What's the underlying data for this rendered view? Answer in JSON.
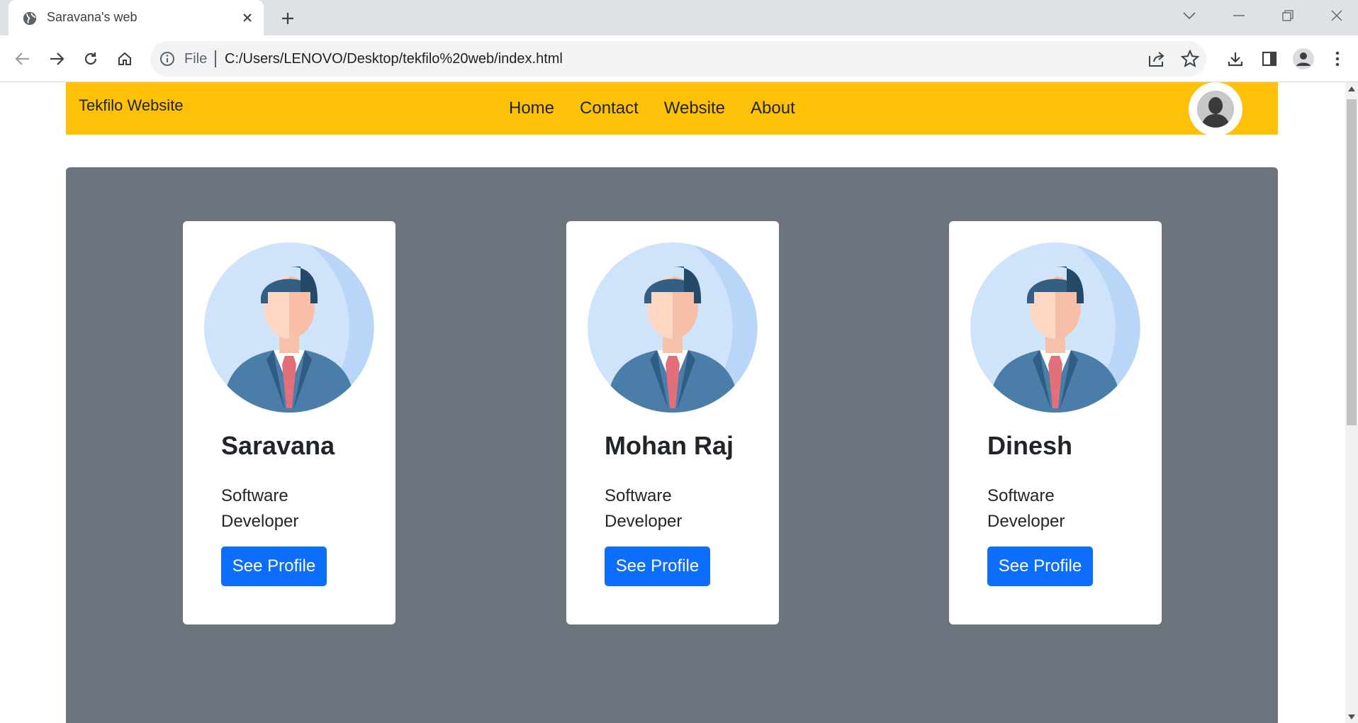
{
  "browser": {
    "tab_title": "Saravana's web",
    "favicon": "globe-icon",
    "address_scheme": "File",
    "address_url": "C:/Users/LENOVO/Desktop/tekfilo%20web/index.html"
  },
  "navbar": {
    "brand": "Tekfilo Website",
    "links": [
      "Home",
      "Contact",
      "Website",
      "About"
    ],
    "background": "#ffc107"
  },
  "hero": {
    "background": "#6c757d"
  },
  "cards": [
    {
      "name": "Saravana",
      "role": "Software Developer",
      "button": "See Profile"
    },
    {
      "name": "Mohan Raj",
      "role": "Software Developer",
      "button": "See Profile"
    },
    {
      "name": "Dinesh",
      "role": "Software Developer",
      "button": "See Profile"
    }
  ],
  "colors": {
    "accent_button": "#0d6efd"
  }
}
